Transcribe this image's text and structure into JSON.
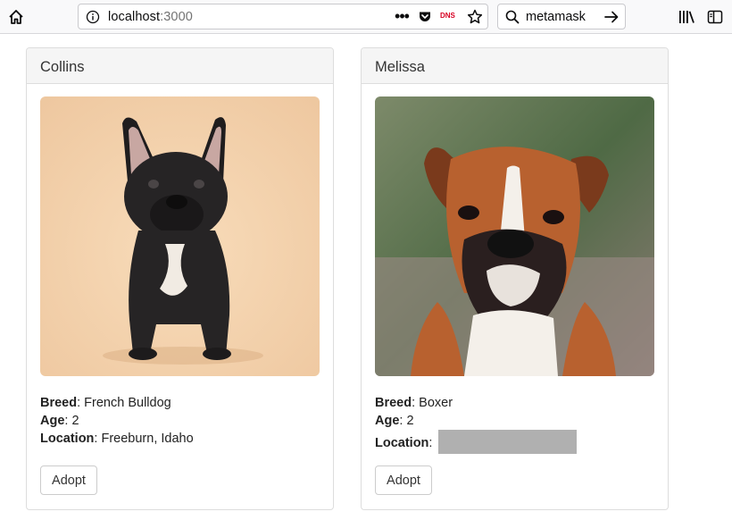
{
  "browser": {
    "url_host": "localhost",
    "url_port": ":3000",
    "dns_badge": "DNS",
    "search_text": "metamask",
    "more_glyph": "•••"
  },
  "pets": [
    {
      "name": "Collins",
      "breed_label": "Breed",
      "breed": "French Bulldog",
      "age_label": "Age",
      "age": "2",
      "location_label": "Location",
      "location": "Freeburn, Idaho",
      "adopt_label": "Adopt"
    },
    {
      "name": "Melissa",
      "breed_label": "Breed",
      "breed": "Boxer",
      "age_label": "Age",
      "age": "2",
      "location_label": "Location",
      "location": "",
      "adopt_label": "Adopt"
    }
  ]
}
